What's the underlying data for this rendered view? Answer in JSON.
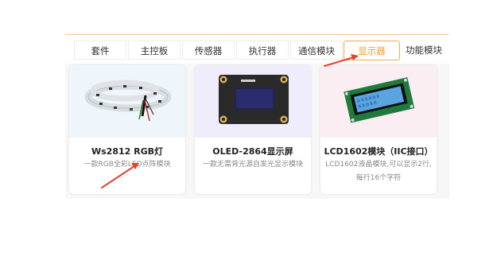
{
  "tabs": [
    {
      "label": "套件"
    },
    {
      "label": "主控板"
    },
    {
      "label": "传感器"
    },
    {
      "label": "执行器"
    },
    {
      "label": "通信模块"
    },
    {
      "label": "显示器",
      "active": true
    },
    {
      "label": "功能模块"
    }
  ],
  "products": [
    {
      "title": "Ws2812 RGB灯",
      "desc_lines": [
        "一款RGB全彩LED点阵模块"
      ]
    },
    {
      "title": "OLED-2864显示屏",
      "desc_lines": [
        "一款无需背光源自发光显示模块"
      ]
    },
    {
      "title": "LCD1602模块（IIC接口）",
      "desc_lines": [
        "LCD1602液晶模块,可以显示2行,",
        "每行16个字符"
      ]
    }
  ],
  "colors": {
    "accent": "#f39a2e",
    "arrow": "#e8412c"
  }
}
